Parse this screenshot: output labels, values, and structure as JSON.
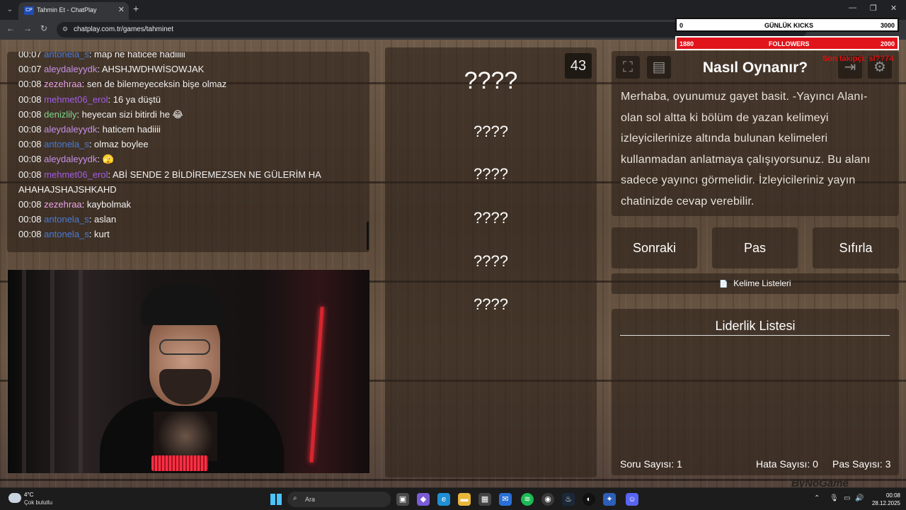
{
  "browser": {
    "tab_title": "Tahmin Et - ChatPlay",
    "tab_favicon": "CP",
    "url": "chatplay.com.tr/games/tahminet"
  },
  "chat": {
    "messages": [
      {
        "time": "00:07",
        "user": "antonela_s",
        "color": "#4a7bd8",
        "text": "map ne haticee hadiiiii"
      },
      {
        "time": "00:07",
        "user": "aleydaleyydk",
        "color": "#c691e8",
        "text": "AHSHJWDHWİSOWJAK"
      },
      {
        "time": "00:08",
        "user": "zezehraa",
        "color": "#e9a3e9",
        "text": "sen de bilemeyeceksin bişe olmaz"
      },
      {
        "time": "00:08",
        "user": "mehmet06_erol",
        "color": "#a35ce6",
        "text": "16 ya düştü"
      },
      {
        "time": "00:08",
        "user": "denizlily",
        "color": "#7fd68d",
        "text": "heyecan sizi bitirdi he 😂"
      },
      {
        "time": "00:08",
        "user": "aleydaleyydk",
        "color": "#c691e8",
        "text": "haticem hadiiii"
      },
      {
        "time": "00:08",
        "user": "antonela_s",
        "color": "#4a7bd8",
        "text": "olmaz boylee"
      },
      {
        "time": "00:08",
        "user": "aleydaleyydk",
        "color": "#c691e8",
        "text": "🫣"
      },
      {
        "time": "00:08",
        "user": "mehmet06_erol",
        "color": "#a35ce6",
        "text": "ABİ SENDE 2 BİLDİREMEZSEN NE GÜLERİM HA"
      },
      {
        "time": "",
        "user": "",
        "color": "#fff",
        "text": "AHAHAJSHAJSHKAHD"
      },
      {
        "time": "00:08",
        "user": "zezehraa",
        "color": "#e9a3e9",
        "text": "kaybolmak"
      },
      {
        "time": "00:08",
        "user": "antonela_s",
        "color": "#4a7bd8",
        "text": "aslan"
      },
      {
        "time": "00:08",
        "user": "antonela_s",
        "color": "#4a7bd8",
        "text": "kurt"
      }
    ]
  },
  "game": {
    "counter": "43",
    "main_word": "????",
    "forbidden_words": [
      "????",
      "????",
      "????",
      "????",
      "????"
    ]
  },
  "how_to_play": {
    "title": "Nasıl Oynanır?",
    "text": "Merhaba, oyunumuz gayet basit. -Yayıncı Alanı- olan sol altta ki bölüm de yazan kelimeyi izleyicilerinize altında bulunan kelimeleri kullanmadan anlatmaya çalışıyorsunuz. Bu alanı sadece yayıncı görmelidir. İzleyicileriniz yayın chatinizde cevap verebilir."
  },
  "buttons": {
    "next": "Sonraki",
    "pass": "Pas",
    "reset": "Sıfırla",
    "word_lists": "Kelime Listeleri",
    "word_lists_icon": "📄"
  },
  "leaderboard": {
    "title": "Liderlik Listesi",
    "question_label": "Soru Sayısı:",
    "question_count": "1",
    "error_label": "Hata Sayısı:",
    "error_count": "0",
    "pass_label": "Pas Sayısı:",
    "pass_count": "3"
  },
  "overlay": {
    "kicks_left": "0",
    "kicks_label": "GÜNLÜK KICKS",
    "kicks_right": "3000",
    "followers_left": "1880",
    "followers_label": "FOLLOWERS",
    "followers_right": "2000",
    "red_text": "Son takipçi: sl??74",
    "watermark": "ByNoGame"
  },
  "taskbar": {
    "temp": "4°C",
    "weather": "Çok bulutlu",
    "search_placeholder": "Ara",
    "time": "00:08",
    "date": "28.12.2025"
  }
}
